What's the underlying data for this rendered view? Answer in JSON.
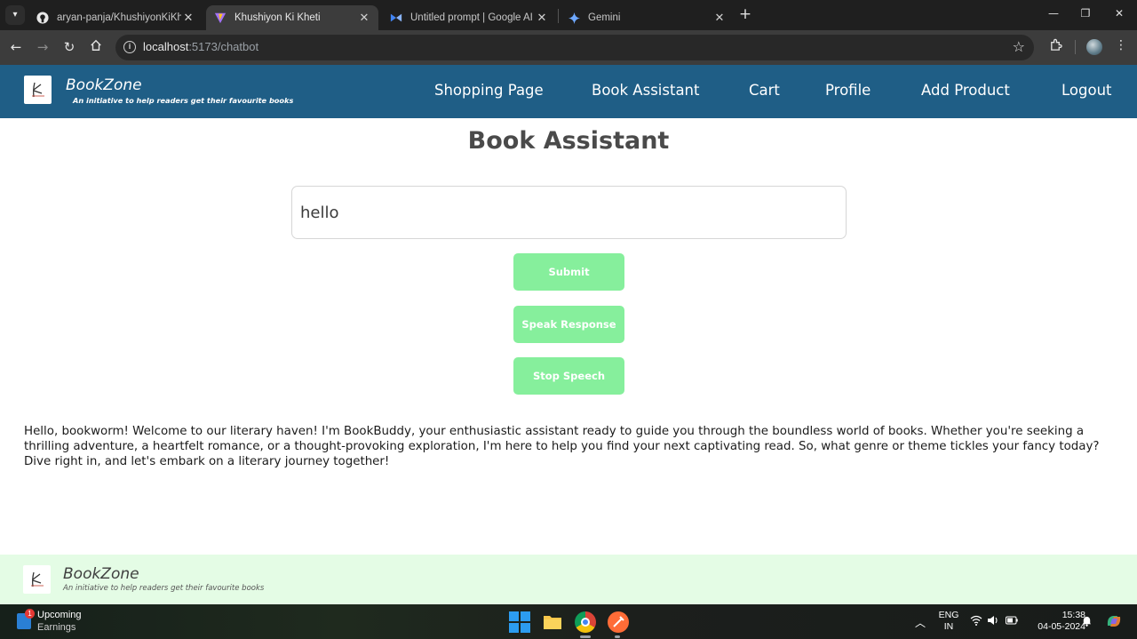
{
  "browser": {
    "tabs": [
      {
        "title": "aryan-panja/KhushiyonKiKheti: a",
        "active": false,
        "icon": "github-icon"
      },
      {
        "title": "Khushiyon Ki Kheti",
        "active": true,
        "icon": "vite-icon"
      },
      {
        "title": "Untitled prompt | Google AI Stu",
        "active": false,
        "icon": "ai-studio-icon"
      },
      {
        "title": "Gemini",
        "active": false,
        "icon": "gemini-icon"
      }
    ],
    "address": {
      "host": "localhost",
      "path": ":5173/chatbot"
    }
  },
  "header": {
    "brand_name": "BookZone",
    "tagline": "An initiative to help readers get their favourite books",
    "nav": [
      "Shopping Page",
      "Book Assistant",
      "Cart",
      "Profile",
      "Add Product",
      "Logout"
    ]
  },
  "main": {
    "title": "Book Assistant",
    "query_value": "hello",
    "submit_label": "Submit",
    "speak_label": "Speak Response",
    "stop_label": "Stop Speech",
    "response": "Hello, bookworm! Welcome to our literary haven! I'm BookBuddy, your enthusiastic assistant ready to guide you through the boundless world of books. Whether you're seeking a thrilling adventure, a heartfelt romance, or a thought-provoking exploration, I'm here to help you find your next captivating read. So, what genre or theme tickles your fancy today? Dive right in, and let's embark on a literary journey together!"
  },
  "footer": {
    "brand_name": "BookZone",
    "tagline": "An initiative to help readers get their favourite books"
  },
  "taskbar": {
    "widget_badge": "1",
    "widget_title": "Upcoming",
    "widget_subtitle": "Earnings",
    "lang_top": "ENG",
    "lang_bottom": "IN",
    "time": "15:38",
    "date": "04-05-2024"
  },
  "colors": {
    "header_bg": "#1f5e86",
    "button_bg": "#86ef9c",
    "footer_bg": "#e4fce5"
  }
}
